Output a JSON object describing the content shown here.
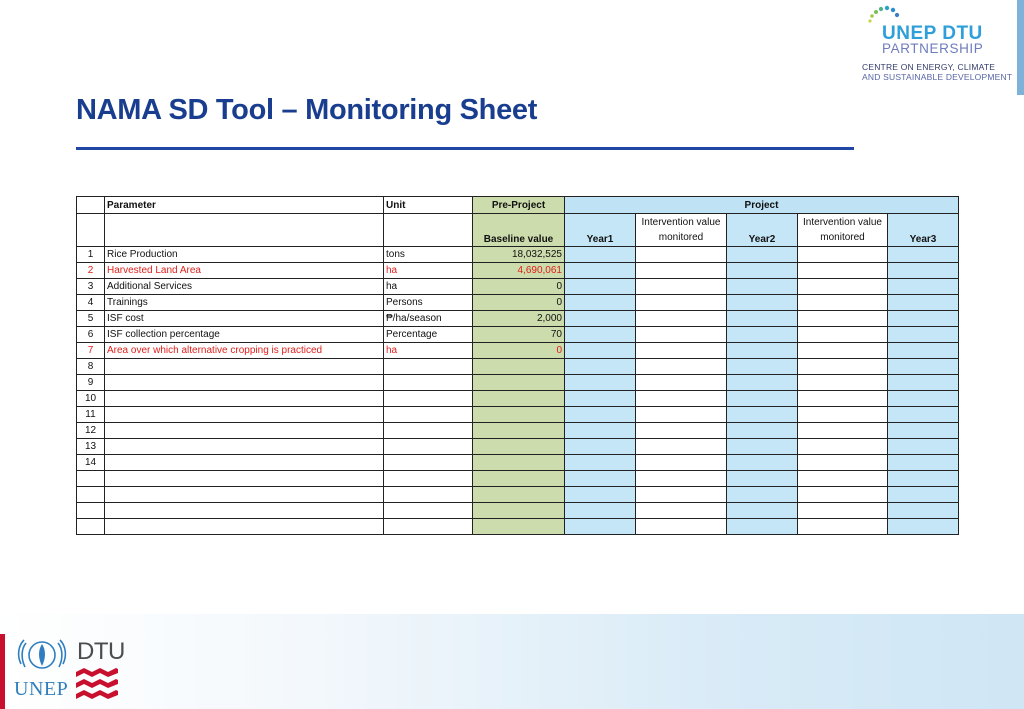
{
  "brand": {
    "title": "UNEP DTU",
    "subtitle": "PARTNERSHIP",
    "centre_line1": "CENTRE ON ENERGY, CLIMATE",
    "centre_line2": "AND SUSTAINABLE DEVELOPMENT"
  },
  "page_title": "NAMA SD Tool – Monitoring Sheet",
  "table": {
    "header": {
      "parameter": "Parameter",
      "unit": "Unit",
      "pre_project": "Pre-Project",
      "project": "Project",
      "baseline_value": "Baseline value",
      "year1": "Year1",
      "intervention1": "Intervention value monitored",
      "year2": "Year2",
      "intervention2": "Intervention value monitored",
      "year3": "Year3"
    },
    "rows": [
      {
        "num": "1",
        "parameter": "Rice Production",
        "unit": "tons",
        "baseline": "18,032,525"
      },
      {
        "num": "2",
        "parameter": "Harvested Land Area",
        "unit": "ha",
        "baseline": "4,690,061"
      },
      {
        "num": "3",
        "parameter": "Additional Services",
        "unit": "ha",
        "baseline": "0"
      },
      {
        "num": "4",
        "parameter": "Trainings",
        "unit": "Persons",
        "baseline": "0"
      },
      {
        "num": "5",
        "parameter": "ISF cost",
        "unit": "₱/ha/season",
        "baseline": "2,000"
      },
      {
        "num": "6",
        "parameter": "ISF collection percentage",
        "unit": "Percentage",
        "baseline": "70"
      },
      {
        "num": "7",
        "parameter": "Area over which alternative cropping is practiced",
        "unit": "ha",
        "baseline": "0"
      },
      {
        "num": "8",
        "parameter": "",
        "unit": "",
        "baseline": ""
      },
      {
        "num": "9",
        "parameter": "",
        "unit": "",
        "baseline": ""
      },
      {
        "num": "10",
        "parameter": "",
        "unit": "",
        "baseline": ""
      },
      {
        "num": "11",
        "parameter": "",
        "unit": "",
        "baseline": ""
      },
      {
        "num": "12",
        "parameter": "",
        "unit": "",
        "baseline": ""
      },
      {
        "num": "13",
        "parameter": "",
        "unit": "",
        "baseline": ""
      },
      {
        "num": "14",
        "parameter": "",
        "unit": "",
        "baseline": ""
      },
      {
        "num": "",
        "parameter": "",
        "unit": "",
        "baseline": ""
      },
      {
        "num": "",
        "parameter": "",
        "unit": "",
        "baseline": ""
      },
      {
        "num": "",
        "parameter": "",
        "unit": "",
        "baseline": ""
      },
      {
        "num": "",
        "parameter": "",
        "unit": "",
        "baseline": ""
      }
    ]
  },
  "footer": {
    "unep_label": "UNEP",
    "dtu_label": "DTU"
  },
  "colors": {
    "title_blue": "#1a3e8f",
    "baseline_green": "#cddcac",
    "project_blue": "#c5e6f6",
    "highlight_red": "#e0201b"
  }
}
